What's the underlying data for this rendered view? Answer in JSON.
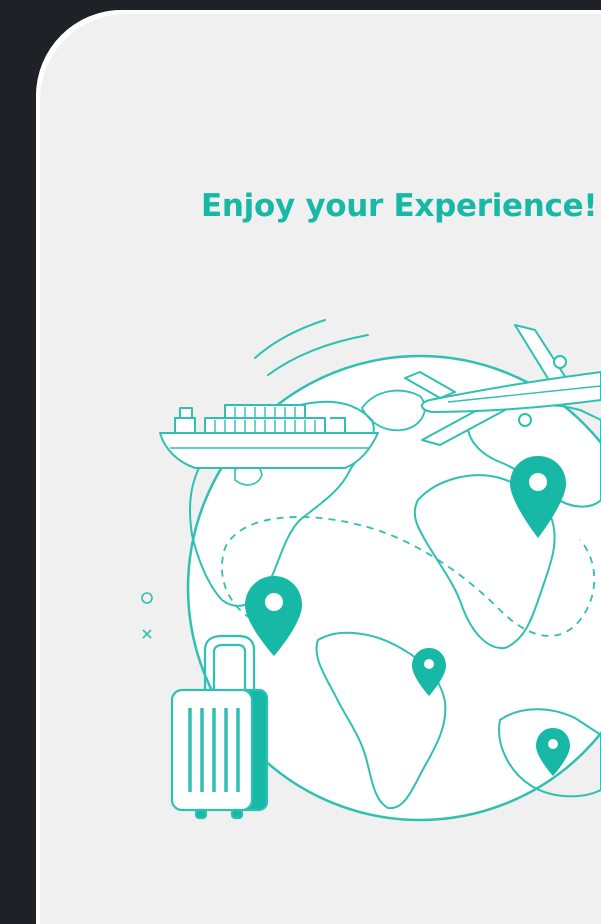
{
  "onboarding": {
    "title": "Enjoy your Experience!"
  },
  "theme": {
    "accent": "#17b8a6",
    "screen_bg": "#f0f0f0",
    "frame_bg": "#1e2226"
  },
  "illustration": {
    "icons": [
      "globe-icon",
      "airplane-icon",
      "cargo-ship-icon",
      "suitcase-icon",
      "location-pin-icon"
    ]
  }
}
